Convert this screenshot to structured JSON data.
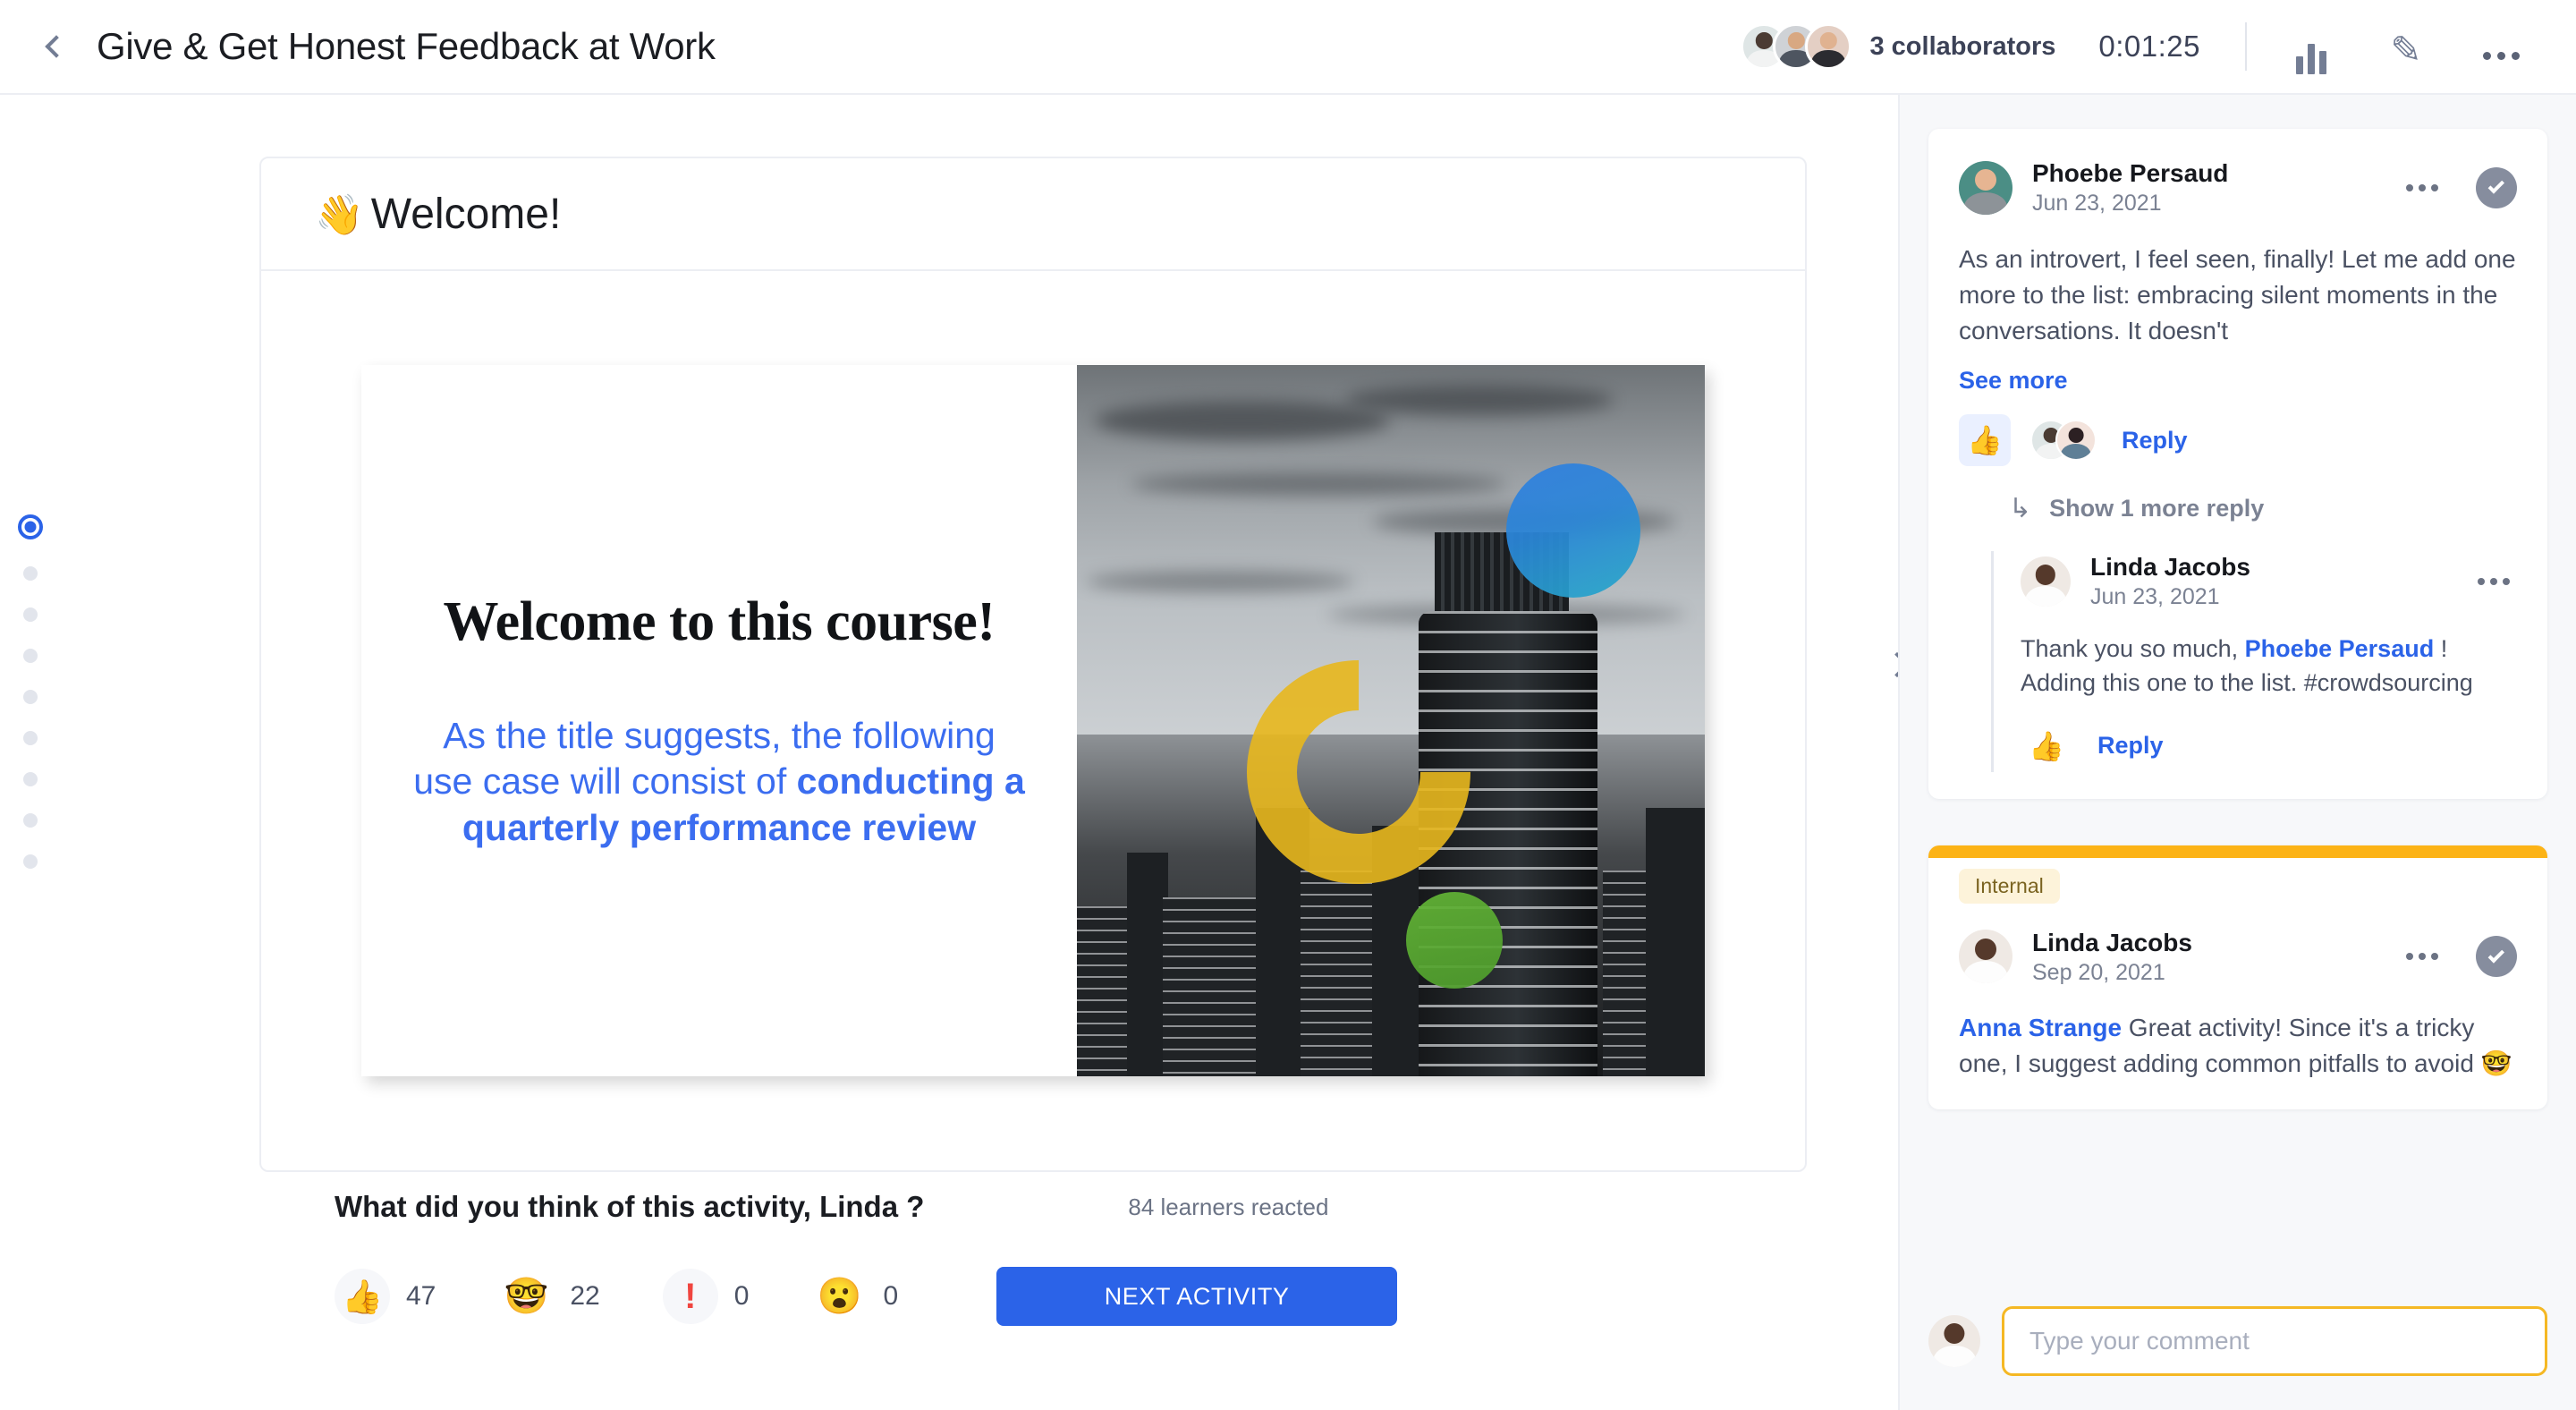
{
  "header": {
    "back_icon": "chevron-left-icon",
    "title": "Give & Get Honest Feedback at Work",
    "collaborators_label": "3 collaborators",
    "timer": "0:01:25",
    "stats_icon": "bar-chart-icon",
    "edit_icon": "pencil-icon",
    "more_icon": "ellipsis-icon"
  },
  "navigation": {
    "total_dots": 9,
    "active_index": 0,
    "next_icon": "chevron-right-icon"
  },
  "activity": {
    "header_emoji": "👋",
    "header_title": "Welcome!",
    "slide": {
      "title": "Welcome to this course!",
      "body_prefix": "As the title suggests, the following use case will consist of ",
      "body_bold": "conducting a quarterly performance review",
      "image_alt": "grayscale-cityscape-with-color-shapes"
    }
  },
  "reactions": {
    "question": "What did you think of this activity, Linda ?",
    "learners_reacted": "84 learners reacted",
    "items": [
      {
        "icon": "thumbs-up-icon",
        "emoji": "👍",
        "count": "47",
        "shaded": true
      },
      {
        "icon": "nerd-face-icon",
        "emoji": "🤓",
        "count": "22",
        "shaded": false
      },
      {
        "icon": "exclamation-icon",
        "emoji": "❗",
        "count": "0",
        "shaded": true
      },
      {
        "icon": "hushed-face-icon",
        "emoji": "😮",
        "count": "0",
        "shaded": false
      }
    ],
    "next_button": "NEXT ACTIVITY"
  },
  "sidebar": {
    "comments": [
      {
        "author": "Phoebe Persaud",
        "date": "Jun 23, 2021",
        "body": "As an introvert, I feel seen, finally! Let me add one more to the list: embracing silent moments in the conversations. It doesn't",
        "see_more": "See more",
        "like_icon": "thumbs-up-icon",
        "reply_label": "Reply",
        "show_more_replies": "Show 1 more reply",
        "more_icon": "ellipsis-icon",
        "resolve_icon": "check-circle-icon",
        "reply": {
          "author": "Linda Jacobs",
          "date": "Jun 23, 2021",
          "body_prefix": "Thank you so much, ",
          "body_mention": "Phoebe Persaud",
          "body_suffix": " ! Adding this one to the list. #crowdsourcing",
          "like_icon": "thumbs-up-outline-icon",
          "reply_label": "Reply",
          "more_icon": "ellipsis-icon"
        }
      },
      {
        "badge": "Internal",
        "author": "Linda Jacobs",
        "date": "Sep 20, 2021",
        "body_mention": "Anna Strange",
        "body": " Great activity! Since it's a tricky one, I suggest adding common pitfalls to avoid 🤓",
        "more_icon": "ellipsis-icon",
        "resolve_icon": "check-circle-icon"
      }
    ],
    "composer": {
      "placeholder": "Type your comment",
      "value": ""
    }
  },
  "colors": {
    "accent_blue": "#2b63e8",
    "accent_yellow": "#fcb316",
    "text_dark": "#1b1d22",
    "text_muted": "#7b8293"
  }
}
